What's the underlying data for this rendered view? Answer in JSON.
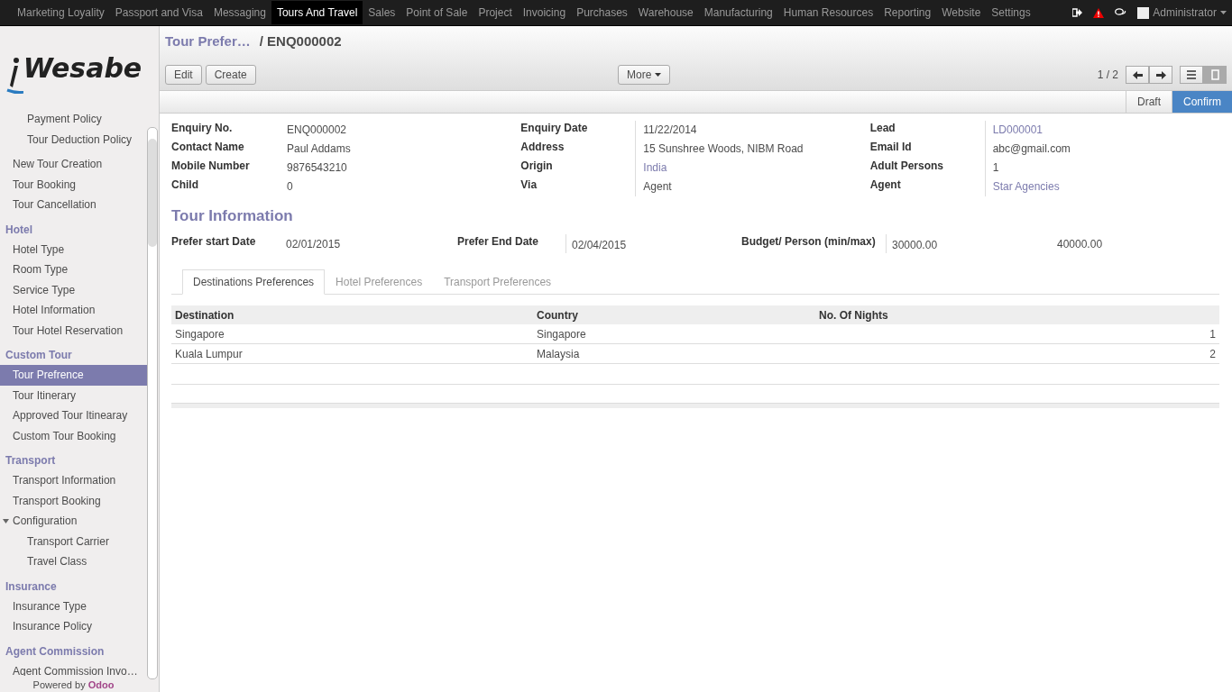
{
  "top_menu": [
    {
      "label": "Marketing Loyality",
      "selected": false
    },
    {
      "label": "Passport and Visa",
      "selected": false
    },
    {
      "label": "Messaging",
      "selected": false
    },
    {
      "label": "Tours And Travel",
      "selected": true
    },
    {
      "label": "Sales",
      "selected": false
    },
    {
      "label": "Point of Sale",
      "selected": false
    },
    {
      "label": "Project",
      "selected": false
    },
    {
      "label": "Invoicing",
      "selected": false
    },
    {
      "label": "Purchases",
      "selected": false
    },
    {
      "label": "Warehouse",
      "selected": false
    },
    {
      "label": "Manufacturing",
      "selected": false
    },
    {
      "label": "Human Resources",
      "selected": false
    },
    {
      "label": "Reporting",
      "selected": false
    },
    {
      "label": "Website",
      "selected": false
    },
    {
      "label": "Settings",
      "selected": false
    }
  ],
  "user": "Administrator",
  "logo": "Wesabe",
  "sidebar": [
    {
      "items": [
        {
          "label": "Payment Policy",
          "kind": "nested",
          "selected": false
        },
        {
          "label": "Tour Deduction Policy",
          "kind": "nested",
          "selected": false
        }
      ]
    },
    {
      "items": [
        {
          "label": "New Tour Creation",
          "kind": "item",
          "selected": false
        },
        {
          "label": "Tour Booking",
          "kind": "item",
          "selected": false
        },
        {
          "label": "Tour Cancellation",
          "kind": "item",
          "selected": false
        }
      ]
    },
    {
      "header": "Hotel",
      "items": [
        {
          "label": "Hotel Type",
          "kind": "item",
          "selected": false
        },
        {
          "label": "Room Type",
          "kind": "item",
          "selected": false
        },
        {
          "label": "Service Type",
          "kind": "item",
          "selected": false
        },
        {
          "label": "Hotel Information",
          "kind": "item",
          "selected": false
        },
        {
          "label": "Tour Hotel Reservation",
          "kind": "item",
          "selected": false
        }
      ]
    },
    {
      "header": "Custom Tour",
      "items": [
        {
          "label": "Tour Prefrence",
          "kind": "item",
          "selected": true
        },
        {
          "label": "Tour Itinerary",
          "kind": "item",
          "selected": false
        },
        {
          "label": "Approved Tour Itinearay",
          "kind": "item",
          "selected": false
        },
        {
          "label": "Custom Tour Booking",
          "kind": "item",
          "selected": false
        }
      ]
    },
    {
      "header": "Transport",
      "items": [
        {
          "label": "Transport Information",
          "kind": "item",
          "selected": false
        },
        {
          "label": "Transport Booking",
          "kind": "item",
          "selected": false
        },
        {
          "label": "Configuration",
          "kind": "item",
          "selected": false,
          "expanded": true,
          "children": [
            {
              "label": "Transport Carrier",
              "selected": false
            },
            {
              "label": "Travel Class",
              "selected": false
            }
          ]
        }
      ]
    },
    {
      "header": "Insurance",
      "items": [
        {
          "label": "Insurance Type",
          "kind": "item",
          "selected": false
        },
        {
          "label": "Insurance Policy",
          "kind": "item",
          "selected": false
        }
      ]
    },
    {
      "header": "Agent Commission",
      "items": [
        {
          "label": "Agent Commission Invo…",
          "kind": "item",
          "selected": false
        }
      ]
    }
  ],
  "powered_by": "Powered by **Odoo**",
  "breadcrumb": {
    "parent": "Tour Prefer…",
    "current": "/ ENQ000002"
  },
  "buttons": [
    "Edit",
    "Create"
  ],
  "more_button": "More",
  "pager": "1 / 2",
  "views": [
    {
      "kind": "list",
      "selected": false
    },
    {
      "kind": "form",
      "selected": true
    }
  ],
  "stages": [
    {
      "label": "Draft",
      "selected": false
    },
    {
      "label": "Confirm",
      "selected": true
    }
  ],
  "fields": [
    [
      {
        "label": "Enquiry No.",
        "value": "ENQ000002",
        "kind": "text"
      },
      {
        "label": "Contact Name",
        "value": "Paul Addams",
        "kind": "text"
      },
      {
        "label": "Mobile Number",
        "value": "9876543210",
        "kind": "text"
      },
      {
        "label": "Child",
        "value": "0",
        "kind": "text"
      }
    ],
    [
      {
        "label": "Enquiry Date",
        "value": "11/22/2014",
        "kind": "text"
      },
      {
        "label": "Address",
        "value": "15 Sunshree Woods, NIBM Road",
        "kind": "text"
      },
      {
        "label": "Origin",
        "value": "India",
        "kind": "link"
      },
      {
        "label": "Via",
        "value": "Agent",
        "kind": "text"
      }
    ],
    [
      {
        "label": "Lead",
        "value": "LD000001",
        "kind": "link"
      },
      {
        "label": "Email Id",
        "value": "abc@gmail.com",
        "kind": "text"
      },
      {
        "label": "Adult Persons",
        "value": "1",
        "kind": "text"
      },
      {
        "label": "Agent",
        "value": "Star Agencies",
        "kind": "link"
      }
    ]
  ],
  "tour_information": {
    "title": "Tour Information",
    "start_label": "Prefer start Date",
    "start": "02/01/2015",
    "end_label": "Prefer End Date",
    "end": "02/04/2015",
    "budget_label": "Budget/ Person (min/max)",
    "budget_min": "30000.00",
    "budget_max": "40000.00"
  },
  "tabs": [
    {
      "label": "Destinations Preferences",
      "selected": true
    },
    {
      "label": "Hotel Preferences",
      "selected": false
    },
    {
      "label": "Transport Preferences",
      "selected": false
    }
  ],
  "table": {
    "columns": [
      "Destination",
      "Country",
      "No. Of Nights"
    ],
    "rows": [
      [
        "Singapore",
        "Singapore",
        "1"
      ],
      [
        "Kuala Lumpur",
        "Malaysia",
        "2"
      ]
    ]
  }
}
